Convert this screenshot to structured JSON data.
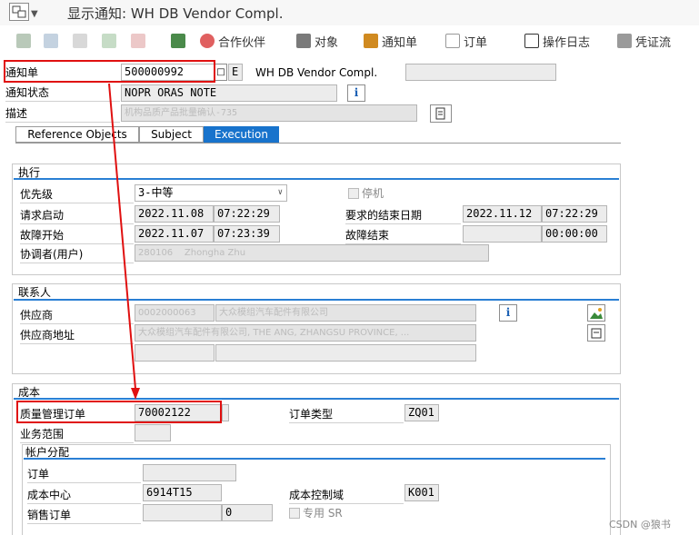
{
  "title": "显示通知: WH DB Vendor Compl.",
  "toolbar": {
    "partners": "合作伙伴",
    "objects": "对象",
    "notification": "通知单",
    "order": "订单",
    "action_log": "操作日志",
    "documents": "凭证流"
  },
  "header": {
    "notification_label": "通知单",
    "notification_value": "500000992",
    "notification_type": "E",
    "notification_text": "WH DB Vendor Compl.",
    "status_label": "通知状态",
    "status_value": "NOPR ORAS NOTE",
    "desc_label": "描述",
    "desc_value": "机构品质产品批量确认-735"
  },
  "tabs": [
    "Reference Objects",
    "Subject",
    "Execution"
  ],
  "exec": {
    "section": "执行",
    "priority_label": "优先级",
    "priority_value": "3-中等",
    "breakdown_label": "停机",
    "req_start_label": "请求启动",
    "req_start_date": "2022.11.08",
    "req_start_time": "07:22:29",
    "req_end_label": "要求的结束日期",
    "req_end_date": "2022.11.12",
    "req_end_time": "07:22:29",
    "fault_start_label": "故障开始",
    "fault_start_date": "2022.11.07",
    "fault_start_time": "07:23:39",
    "fault_end_label": "故障结束",
    "fault_end_time": "00:00:00",
    "coordinator_label": "协调者(用户)",
    "coordinator_id": "280106",
    "coordinator_name": "Zhongha Zhu"
  },
  "contact": {
    "section": "联系人",
    "vendor_label": "供应商",
    "vendor_id": "0002000063",
    "vendor_name": "大众模组汽车配件有限公司",
    "address_label": "供应商地址",
    "address_value": "大众模组汽车配件有限公司, THE ANG, ZHANGSU PROVINCE, ..."
  },
  "cost": {
    "section": "成本",
    "qm_order_label": "质量管理订单",
    "qm_order_value": "70002122",
    "order_type_label": "订单类型",
    "order_type_value": "ZQ01",
    "business_area_label": "业务范围",
    "account_section": "帐户分配",
    "order_label": "订单",
    "cost_center_label": "成本中心",
    "cost_center_value": "6914T15",
    "controlling_area_label": "成本控制域",
    "controlling_area_value": "K001",
    "sales_order_label": "销售订单",
    "sales_order_item": "0",
    "special_label": "专用 SR"
  },
  "watermark": "CSDN @狼书",
  "colors": {
    "tab_active": "#1873cc",
    "section_line": "#2a7fd4",
    "annotation": "#e01010"
  }
}
